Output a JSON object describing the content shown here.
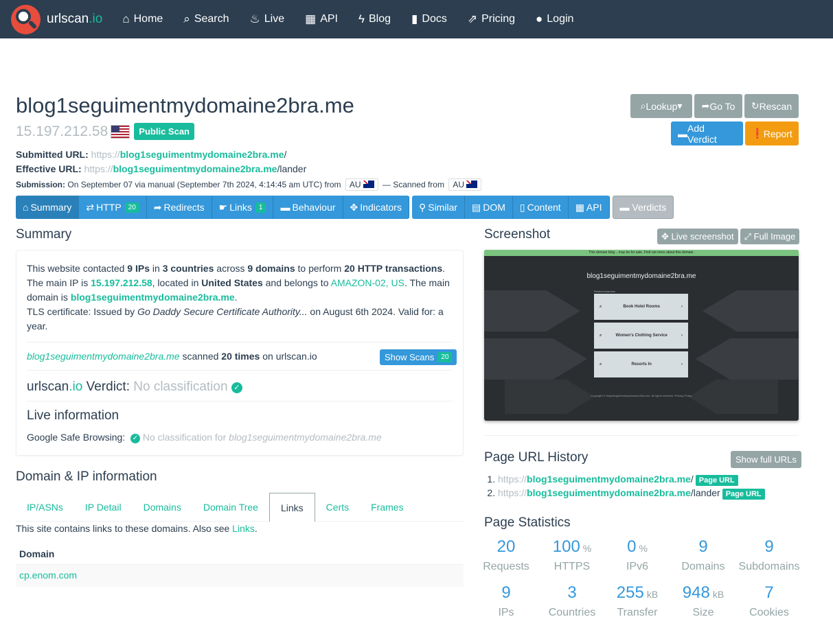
{
  "nav": {
    "brand_main": "urlscan",
    "brand_io": ".io",
    "items": [
      {
        "label": "Home",
        "icon": "home-icon",
        "glyph": "⌂"
      },
      {
        "label": "Search",
        "icon": "search-icon",
        "glyph": "⌕"
      },
      {
        "label": "Live",
        "icon": "fire-icon",
        "glyph": "♨"
      },
      {
        "label": "API",
        "icon": "qrcode-icon",
        "glyph": "▦"
      },
      {
        "label": "Blog",
        "icon": "bolt-icon",
        "glyph": "ϟ"
      },
      {
        "label": "Docs",
        "icon": "bookmark-icon",
        "glyph": "▮"
      },
      {
        "label": "Pricing",
        "icon": "external-link-icon",
        "glyph": "⇗"
      },
      {
        "label": "Login",
        "icon": "user-icon",
        "glyph": "●"
      }
    ]
  },
  "scan": {
    "domain": "blog1seguimentmydomaine2bra.me",
    "ip": "15.197.212.58",
    "badge": "Public Scan",
    "submitted_label": "Submitted URL:",
    "submitted_prefix": "https://",
    "submitted_domain": "blog1seguimentmydomaine2bra.me",
    "submitted_suffix": "/",
    "effective_label": "Effective URL:",
    "effective_prefix": "https://",
    "effective_domain": "blog1seguimentmydomaine2bra.me",
    "effective_suffix": "/lander",
    "submission_label": "Submission:",
    "submission_text": "On September 07 via manual (September 7th 2024, 4:14:45 am UTC) from",
    "from_cc": "AU",
    "scanned_text": "— Scanned from",
    "scan_cc": "AU"
  },
  "actions": {
    "lookup": "Lookup",
    "goto": "Go To",
    "rescan": "Rescan",
    "add_verdict": "Add Verdict",
    "report": "Report"
  },
  "tabs": {
    "group1": [
      {
        "label": "Summary"
      },
      {
        "label": "HTTP",
        "count": "20"
      },
      {
        "label": "Redirects"
      },
      {
        "label": "Links",
        "count": "1"
      },
      {
        "label": "Behaviour"
      },
      {
        "label": "Indicators"
      }
    ],
    "group2": [
      {
        "label": "Similar"
      },
      {
        "label": "DOM"
      },
      {
        "label": "Content"
      },
      {
        "label": "API"
      }
    ],
    "verdicts": "Verdicts"
  },
  "summary": {
    "heading": "Summary",
    "s1": "This website contacted ",
    "b1": "9 IPs",
    "s2": " in ",
    "b2": "3 countries",
    "s3": " across ",
    "b3": "9 domains",
    "s4": " to perform ",
    "b4": "20 HTTP transactions",
    "s5": ". The main IP is ",
    "ip": "15.197.212.58",
    "s6": ", located in ",
    "country": "United States",
    "s7": " and belongs to ",
    "asn": "AMAZON-02, US",
    "s8": ". The main domain is ",
    "domain": "blog1seguimentmydomaine2bra.me",
    "s9": ".",
    "tls_a": "TLS certificate: Issued by ",
    "tls_issuer": "Go Daddy Secure Certificate Authority...",
    "tls_b": " on August 6th 2024. Valid for: a year.",
    "scanned_domain": "blog1seguimentmydomaine2bra.me",
    "scanned_a": " scanned ",
    "scanned_times": "20 times",
    "scanned_b": " on urlscan.io",
    "show_scans": "Show Scans",
    "show_scans_count": "20",
    "verdict_a": "urlscan",
    "verdict_io": ".io",
    "verdict_b": " Verdict: ",
    "verdict_val": "No classification",
    "live_heading": "Live information",
    "gsb_label": "Google Safe Browsing:",
    "gsb_val": "No classification for ",
    "gsb_domain": "blog1seguimentmydomaine2bra.me"
  },
  "domainip": {
    "heading": "Domain & IP information",
    "tabs": [
      "IP/ASNs",
      "IP Detail",
      "Domains",
      "Domain Tree",
      "Links",
      "Certs",
      "Frames"
    ],
    "note_a": "This site contains links to these domains. Also see ",
    "note_link": "Links",
    "note_b": ".",
    "col": "Domain",
    "rows": [
      "cp.enom.com"
    ]
  },
  "screenshot": {
    "heading": "Screenshot",
    "live": "Live screenshot",
    "full": "Full Image",
    "banner": "This domain blog... may be for sale. Find out more about this domain.",
    "title": "blog1seguimentmydomaine2bra.me",
    "related": "Related searches",
    "items": [
      "Book Hotel Rooms",
      "Women's Clothing Service",
      "Resorts In"
    ],
    "footer": "Copyright © blog1seguimentmydomaine2bra.me. All rights reserved. Privacy Policy"
  },
  "history": {
    "heading": "Page URL History",
    "show_full": "Show full URLs",
    "items": [
      {
        "prefix": "https://",
        "domain": "blog1seguimentmydomaine2bra.me",
        "suffix": "/",
        "tag": "Page URL"
      },
      {
        "prefix": "https://",
        "domain": "blog1seguimentmydomaine2bra.me",
        "suffix": "/lander",
        "tag": "Page URL"
      }
    ]
  },
  "stats": {
    "heading": "Page Statistics",
    "items": [
      {
        "num": "20",
        "unit": "",
        "label": "Requests"
      },
      {
        "num": "100",
        "unit": "%",
        "label": "HTTPS"
      },
      {
        "num": "0",
        "unit": "%",
        "label": "IPv6"
      },
      {
        "num": "9",
        "unit": "",
        "label": "Domains"
      },
      {
        "num": "9",
        "unit": "",
        "label": "Subdomains"
      },
      {
        "num": "9",
        "unit": "",
        "label": "IPs"
      },
      {
        "num": "3",
        "unit": "",
        "label": "Countries"
      },
      {
        "num": "255",
        "unit": "kB",
        "label": "Transfer"
      },
      {
        "num": "948",
        "unit": "kB",
        "label": "Size"
      },
      {
        "num": "7",
        "unit": "",
        "label": "Cookies"
      }
    ]
  }
}
